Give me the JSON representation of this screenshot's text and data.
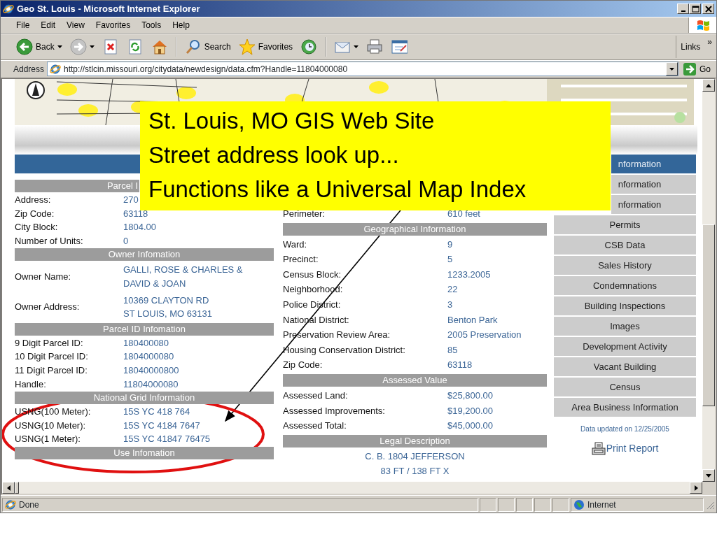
{
  "window": {
    "title": "Geo St. Louis - Microsoft Internet Explorer"
  },
  "menu_bar": [
    "File",
    "Edit",
    "View",
    "Favorites",
    "Tools",
    "Help"
  ],
  "toolbar": [
    {
      "kind": "back",
      "label": "Back",
      "menu": true
    },
    {
      "kind": "forward",
      "menu": true
    },
    {
      "kind": "stop"
    },
    {
      "kind": "refresh"
    },
    {
      "kind": "home"
    },
    {
      "kind": "separator"
    },
    {
      "kind": "search",
      "label": "Search"
    },
    {
      "kind": "favorites",
      "label": "Favorites"
    },
    {
      "kind": "history"
    },
    {
      "kind": "separator"
    },
    {
      "kind": "mail",
      "menu": true
    },
    {
      "kind": "print"
    },
    {
      "kind": "edit"
    }
  ],
  "links": {
    "label": "Links",
    "more": "»"
  },
  "address_bar": {
    "label": "Address",
    "value": "http://stlcin.missouri.org/citydata/newdesign/data.cfm?Handle=11804000080",
    "go": "Go"
  },
  "page": {
    "left": [
      {
        "kind": "partial_heading",
        "text": "Parcel I"
      },
      {
        "kind": "row",
        "label": "Address:",
        "value": [
          "270"
        ]
      },
      {
        "kind": "row",
        "label": "Zip Code:",
        "value": [
          "63118"
        ]
      },
      {
        "kind": "row",
        "label": "City Block:",
        "value": [
          "1804.00"
        ]
      },
      {
        "kind": "row",
        "label": "Number of Units:",
        "value": [
          "0"
        ]
      },
      {
        "kind": "heading",
        "text": "Owner Infomation"
      },
      {
        "kind": "row",
        "label": "Owner Name:",
        "value": [
          "GALLI, ROSE & CHARLES &",
          "DAVID & JOAN"
        ]
      },
      {
        "kind": "row",
        "label": "Owner Address:",
        "value": [
          "10369 CLAYTON RD",
          "ST LOUIS, MO 63131"
        ]
      },
      {
        "kind": "heading",
        "text": "Parcel ID Infomation"
      },
      {
        "kind": "row",
        "label": "9 Digit Parcel ID:",
        "value": [
          "180400080"
        ]
      },
      {
        "kind": "row",
        "label": "10 Digit Parcel ID:",
        "value": [
          "1804000080"
        ]
      },
      {
        "kind": "row",
        "label": "11 Digit Parcel ID:",
        "value": [
          "18040000800"
        ]
      },
      {
        "kind": "row",
        "label": "Handle:",
        "value": [
          "11804000080"
        ]
      },
      {
        "kind": "heading",
        "text": "National Grid Information"
      },
      {
        "kind": "row",
        "label": "USNG(100 Meter):",
        "value": [
          "15S YC 418 764"
        ]
      },
      {
        "kind": "row",
        "label": "USNG(10 Meter):",
        "value": [
          "15S YC 4184 7647"
        ]
      },
      {
        "kind": "row",
        "label": "USNG(1 Meter):",
        "value": [
          "15S YC 41847 76475"
        ]
      },
      {
        "kind": "heading",
        "text": "Use Infomation"
      }
    ],
    "middle": [
      {
        "kind": "row",
        "label": "Perimeter:",
        "value": [
          "610 feet"
        ]
      },
      {
        "kind": "heading",
        "text": "Geographical Information"
      },
      {
        "kind": "row",
        "label": "Ward:",
        "value": [
          "9"
        ]
      },
      {
        "kind": "row",
        "label": "Precinct:",
        "value": [
          "5"
        ]
      },
      {
        "kind": "row",
        "label": "Census Block:",
        "value": [
          "1233.2005"
        ]
      },
      {
        "kind": "row",
        "label": "Neighborhood:",
        "value": [
          "22"
        ]
      },
      {
        "kind": "row",
        "label": "Police District:",
        "value": [
          "3"
        ]
      },
      {
        "kind": "row",
        "label": "National District:",
        "value": [
          "Benton Park"
        ]
      },
      {
        "kind": "row",
        "label": "Preservation Review Area:",
        "value": [
          "2005 Preservation"
        ]
      },
      {
        "kind": "row",
        "label": "Housing Conservation District:",
        "value": [
          "85"
        ]
      },
      {
        "kind": "row",
        "label": "Zip Code:",
        "value": [
          "63118"
        ]
      },
      {
        "kind": "heading",
        "text": "Assessed Value"
      },
      {
        "kind": "row",
        "label": "Assessed Land:",
        "value": [
          "$25,800.00"
        ]
      },
      {
        "kind": "row",
        "label": "Assessed Improvements:",
        "value": [
          "$19,200.00"
        ]
      },
      {
        "kind": "row",
        "label": "Assessed Total:",
        "value": [
          "$45,000.00"
        ]
      },
      {
        "kind": "heading",
        "text": "Legal Description"
      },
      {
        "kind": "text",
        "text": "C. B. 1804 JEFFERSON"
      },
      {
        "kind": "text",
        "text": "83 FT / 138 FT X"
      }
    ],
    "menu": [
      {
        "kind": "partial",
        "label": "nformation",
        "selected": true
      },
      {
        "kind": "partial",
        "label": "nformation",
        "selected": false
      },
      {
        "kind": "partial",
        "label": "nformation",
        "selected": false
      },
      {
        "kind": "link",
        "label": "Permits",
        "selected": false
      },
      {
        "kind": "link",
        "label": "CSB Data",
        "selected": false
      },
      {
        "kind": "link",
        "label": "Sales History",
        "selected": false
      },
      {
        "kind": "link",
        "label": "Condemnations",
        "selected": false
      },
      {
        "kind": "link",
        "label": "Building Inspections",
        "selected": false
      },
      {
        "kind": "link",
        "label": "Images",
        "selected": false
      },
      {
        "kind": "link",
        "label": "Development Activity",
        "selected": false
      },
      {
        "kind": "link",
        "label": "Vacant Building",
        "selected": false
      },
      {
        "kind": "link",
        "label": "Census",
        "selected": false
      },
      {
        "kind": "link",
        "label": "Area Business Information",
        "selected": false
      }
    ],
    "updated": "Data updated on 12/25/2005",
    "print": "Print Report"
  },
  "status_bar": {
    "text": "Done",
    "zone": "Internet"
  },
  "annotation": {
    "lines": [
      "St. Louis, MO GIS Web Site",
      "Street address look up...",
      "Functions like a Universal Map Index"
    ]
  }
}
